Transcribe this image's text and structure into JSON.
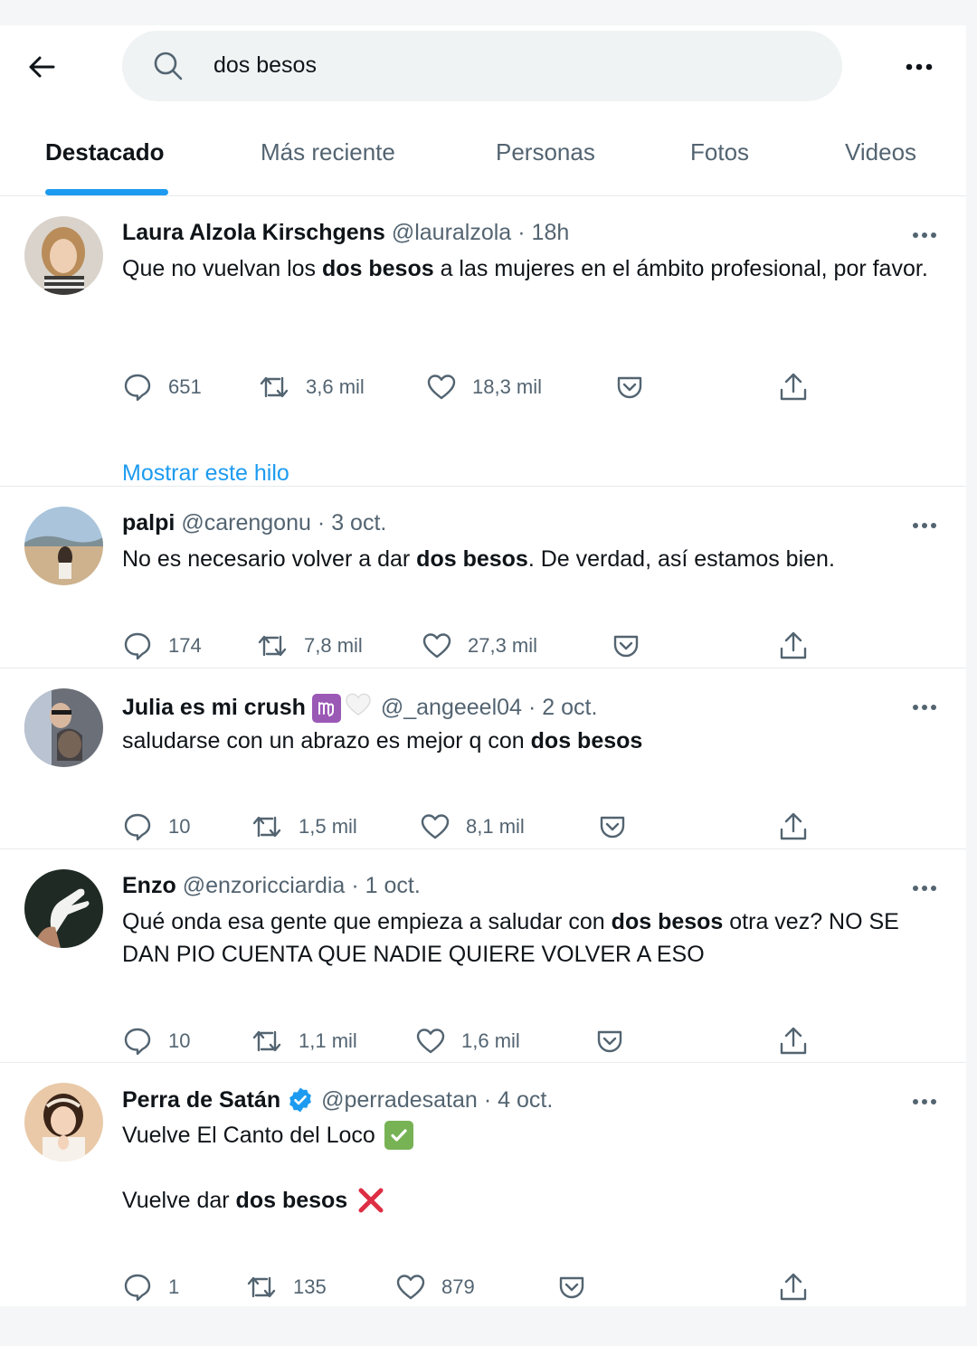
{
  "search": {
    "value": "dos besos"
  },
  "tabs": [
    {
      "label": "Destacado"
    },
    {
      "label": "Más reciente"
    },
    {
      "label": "Personas"
    },
    {
      "label": "Fotos"
    },
    {
      "label": "Videos"
    }
  ],
  "tweets": [
    {
      "name": "Laura Alzola Kirschgens",
      "handle": "@lauralzola",
      "time": "18h",
      "text_before": "Que no vuelvan los ",
      "text_bold": "dos besos",
      "text_after": " a las mujeres en el ámbito profesional, por favor.",
      "replies": "651",
      "retweets": "3,6 mil",
      "likes": "18,3 mil",
      "thread_link": "Mostrar este hilo"
    },
    {
      "name": "palpi",
      "handle": "@carengonu",
      "time": "3 oct.",
      "text_before": "No es necesario volver a dar ",
      "text_bold": "dos besos",
      "text_after": ". De verdad, así estamos bien.",
      "replies": "174",
      "retweets": "7,8 mil",
      "likes": "27,3 mil"
    },
    {
      "name": "Julia es mi crush",
      "name_emojis": [
        "virgo-icon",
        "white-heart-icon"
      ],
      "handle": "@_angeeel04",
      "time": "2 oct.",
      "text_before": "saludarse con un abrazo es mejor q con ",
      "text_bold": "dos besos",
      "text_after": "",
      "replies": "10",
      "retweets": "1,5 mil",
      "likes": "8,1 mil"
    },
    {
      "name": "Enzo",
      "handle": "@enzoricciardia",
      "time": "1 oct.",
      "text_before": "Qué onda esa gente que empieza a saludar con ",
      "text_bold": "dos besos",
      "text_after": " otra vez? NO SE DAN PIO CUENTA QUE NADIE QUIERE VOLVER A ESO",
      "replies": "10",
      "retweets": "1,1 mil",
      "likes": "1,6 mil"
    },
    {
      "name": "Perra de Satán",
      "verified": true,
      "handle": "@perradesatan",
      "time": "4 oct.",
      "line1": "Vuelve El Canto del Loco",
      "line2_before": "Vuelve dar ",
      "line2_bold": "dos besos",
      "replies": "1",
      "retweets": "135",
      "likes": "879"
    }
  ],
  "colors": {
    "accent": "#1d9bf0",
    "text_primary": "#0f1419",
    "text_secondary": "#536471",
    "check_green": "#77b255",
    "cross_red": "#dd2e44",
    "virgo_purple": "#9b59b6"
  }
}
